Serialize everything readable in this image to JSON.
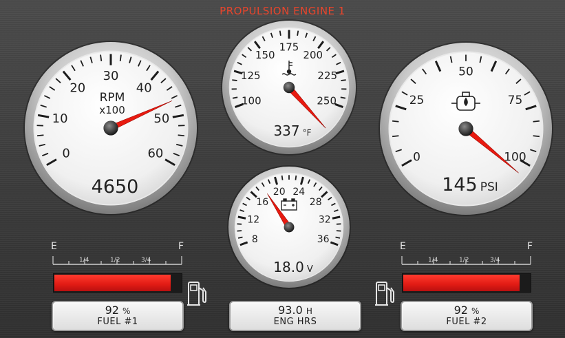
{
  "title": "PROPULSION ENGINE 1",
  "colors": {
    "title": "#e8452c",
    "needle": "#e81a10",
    "bar": "#e11b14"
  },
  "rpm_gauge": {
    "ticks": [
      "0",
      "10",
      "20",
      "30",
      "40",
      "50",
      "60"
    ],
    "label_line1": "RPM",
    "label_line2": "x100",
    "value": "4650"
  },
  "temp_gauge": {
    "ticks": [
      "100",
      "125",
      "150",
      "175",
      "200",
      "225",
      "250"
    ],
    "icon": "coolant-temperature-icon",
    "value": "337",
    "unit": "°F"
  },
  "oil_gauge": {
    "ticks": [
      "0",
      "25",
      "50",
      "75",
      "100"
    ],
    "icon": "oil-can-icon",
    "value": "145",
    "unit": "PSI"
  },
  "volt_gauge": {
    "ticks": [
      "8",
      "12",
      "16",
      "20",
      "24",
      "28",
      "32",
      "36"
    ],
    "icon": "battery-icon",
    "value": "18.0",
    "unit": "V"
  },
  "fuel1": {
    "empty_label": "E",
    "full_label": "F",
    "scale": [
      "1/4",
      "1/2",
      "3/4"
    ],
    "level": 0.92,
    "value": "92",
    "unit": "%",
    "name": "FUEL #1",
    "icon": "fuel-pump-icon"
  },
  "fuel2": {
    "empty_label": "E",
    "full_label": "F",
    "scale": [
      "1/4",
      "1/2",
      "3/4"
    ],
    "level": 0.92,
    "value": "92",
    "unit": "%",
    "name": "FUEL #2",
    "icon": "fuel-pump-icon"
  },
  "engine_hours": {
    "value": "93.0",
    "unit": "H",
    "name": "ENG HRS"
  }
}
